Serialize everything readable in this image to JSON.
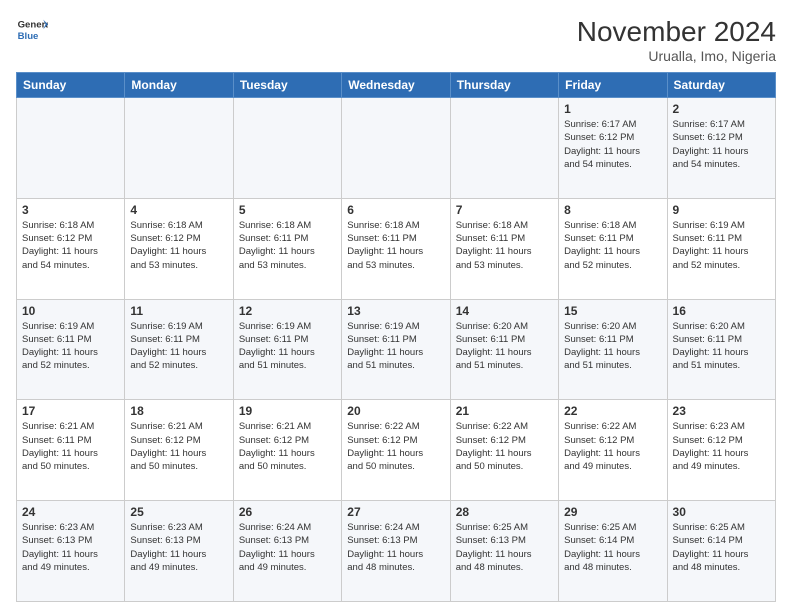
{
  "logo": {
    "line1": "General",
    "line2": "Blue"
  },
  "title": "November 2024",
  "subtitle": "Urualla, Imo, Nigeria",
  "header_days": [
    "Sunday",
    "Monday",
    "Tuesday",
    "Wednesday",
    "Thursday",
    "Friday",
    "Saturday"
  ],
  "weeks": [
    [
      {
        "day": "",
        "info": ""
      },
      {
        "day": "",
        "info": ""
      },
      {
        "day": "",
        "info": ""
      },
      {
        "day": "",
        "info": ""
      },
      {
        "day": "",
        "info": ""
      },
      {
        "day": "1",
        "info": "Sunrise: 6:17 AM\nSunset: 6:12 PM\nDaylight: 11 hours\nand 54 minutes."
      },
      {
        "day": "2",
        "info": "Sunrise: 6:17 AM\nSunset: 6:12 PM\nDaylight: 11 hours\nand 54 minutes."
      }
    ],
    [
      {
        "day": "3",
        "info": "Sunrise: 6:18 AM\nSunset: 6:12 PM\nDaylight: 11 hours\nand 54 minutes."
      },
      {
        "day": "4",
        "info": "Sunrise: 6:18 AM\nSunset: 6:12 PM\nDaylight: 11 hours\nand 53 minutes."
      },
      {
        "day": "5",
        "info": "Sunrise: 6:18 AM\nSunset: 6:11 PM\nDaylight: 11 hours\nand 53 minutes."
      },
      {
        "day": "6",
        "info": "Sunrise: 6:18 AM\nSunset: 6:11 PM\nDaylight: 11 hours\nand 53 minutes."
      },
      {
        "day": "7",
        "info": "Sunrise: 6:18 AM\nSunset: 6:11 PM\nDaylight: 11 hours\nand 53 minutes."
      },
      {
        "day": "8",
        "info": "Sunrise: 6:18 AM\nSunset: 6:11 PM\nDaylight: 11 hours\nand 52 minutes."
      },
      {
        "day": "9",
        "info": "Sunrise: 6:19 AM\nSunset: 6:11 PM\nDaylight: 11 hours\nand 52 minutes."
      }
    ],
    [
      {
        "day": "10",
        "info": "Sunrise: 6:19 AM\nSunset: 6:11 PM\nDaylight: 11 hours\nand 52 minutes."
      },
      {
        "day": "11",
        "info": "Sunrise: 6:19 AM\nSunset: 6:11 PM\nDaylight: 11 hours\nand 52 minutes."
      },
      {
        "day": "12",
        "info": "Sunrise: 6:19 AM\nSunset: 6:11 PM\nDaylight: 11 hours\nand 51 minutes."
      },
      {
        "day": "13",
        "info": "Sunrise: 6:19 AM\nSunset: 6:11 PM\nDaylight: 11 hours\nand 51 minutes."
      },
      {
        "day": "14",
        "info": "Sunrise: 6:20 AM\nSunset: 6:11 PM\nDaylight: 11 hours\nand 51 minutes."
      },
      {
        "day": "15",
        "info": "Sunrise: 6:20 AM\nSunset: 6:11 PM\nDaylight: 11 hours\nand 51 minutes."
      },
      {
        "day": "16",
        "info": "Sunrise: 6:20 AM\nSunset: 6:11 PM\nDaylight: 11 hours\nand 51 minutes."
      }
    ],
    [
      {
        "day": "17",
        "info": "Sunrise: 6:21 AM\nSunset: 6:11 PM\nDaylight: 11 hours\nand 50 minutes."
      },
      {
        "day": "18",
        "info": "Sunrise: 6:21 AM\nSunset: 6:12 PM\nDaylight: 11 hours\nand 50 minutes."
      },
      {
        "day": "19",
        "info": "Sunrise: 6:21 AM\nSunset: 6:12 PM\nDaylight: 11 hours\nand 50 minutes."
      },
      {
        "day": "20",
        "info": "Sunrise: 6:22 AM\nSunset: 6:12 PM\nDaylight: 11 hours\nand 50 minutes."
      },
      {
        "day": "21",
        "info": "Sunrise: 6:22 AM\nSunset: 6:12 PM\nDaylight: 11 hours\nand 50 minutes."
      },
      {
        "day": "22",
        "info": "Sunrise: 6:22 AM\nSunset: 6:12 PM\nDaylight: 11 hours\nand 49 minutes."
      },
      {
        "day": "23",
        "info": "Sunrise: 6:23 AM\nSunset: 6:12 PM\nDaylight: 11 hours\nand 49 minutes."
      }
    ],
    [
      {
        "day": "24",
        "info": "Sunrise: 6:23 AM\nSunset: 6:13 PM\nDaylight: 11 hours\nand 49 minutes."
      },
      {
        "day": "25",
        "info": "Sunrise: 6:23 AM\nSunset: 6:13 PM\nDaylight: 11 hours\nand 49 minutes."
      },
      {
        "day": "26",
        "info": "Sunrise: 6:24 AM\nSunset: 6:13 PM\nDaylight: 11 hours\nand 49 minutes."
      },
      {
        "day": "27",
        "info": "Sunrise: 6:24 AM\nSunset: 6:13 PM\nDaylight: 11 hours\nand 48 minutes."
      },
      {
        "day": "28",
        "info": "Sunrise: 6:25 AM\nSunset: 6:13 PM\nDaylight: 11 hours\nand 48 minutes."
      },
      {
        "day": "29",
        "info": "Sunrise: 6:25 AM\nSunset: 6:14 PM\nDaylight: 11 hours\nand 48 minutes."
      },
      {
        "day": "30",
        "info": "Sunrise: 6:25 AM\nSunset: 6:14 PM\nDaylight: 11 hours\nand 48 minutes."
      }
    ]
  ]
}
